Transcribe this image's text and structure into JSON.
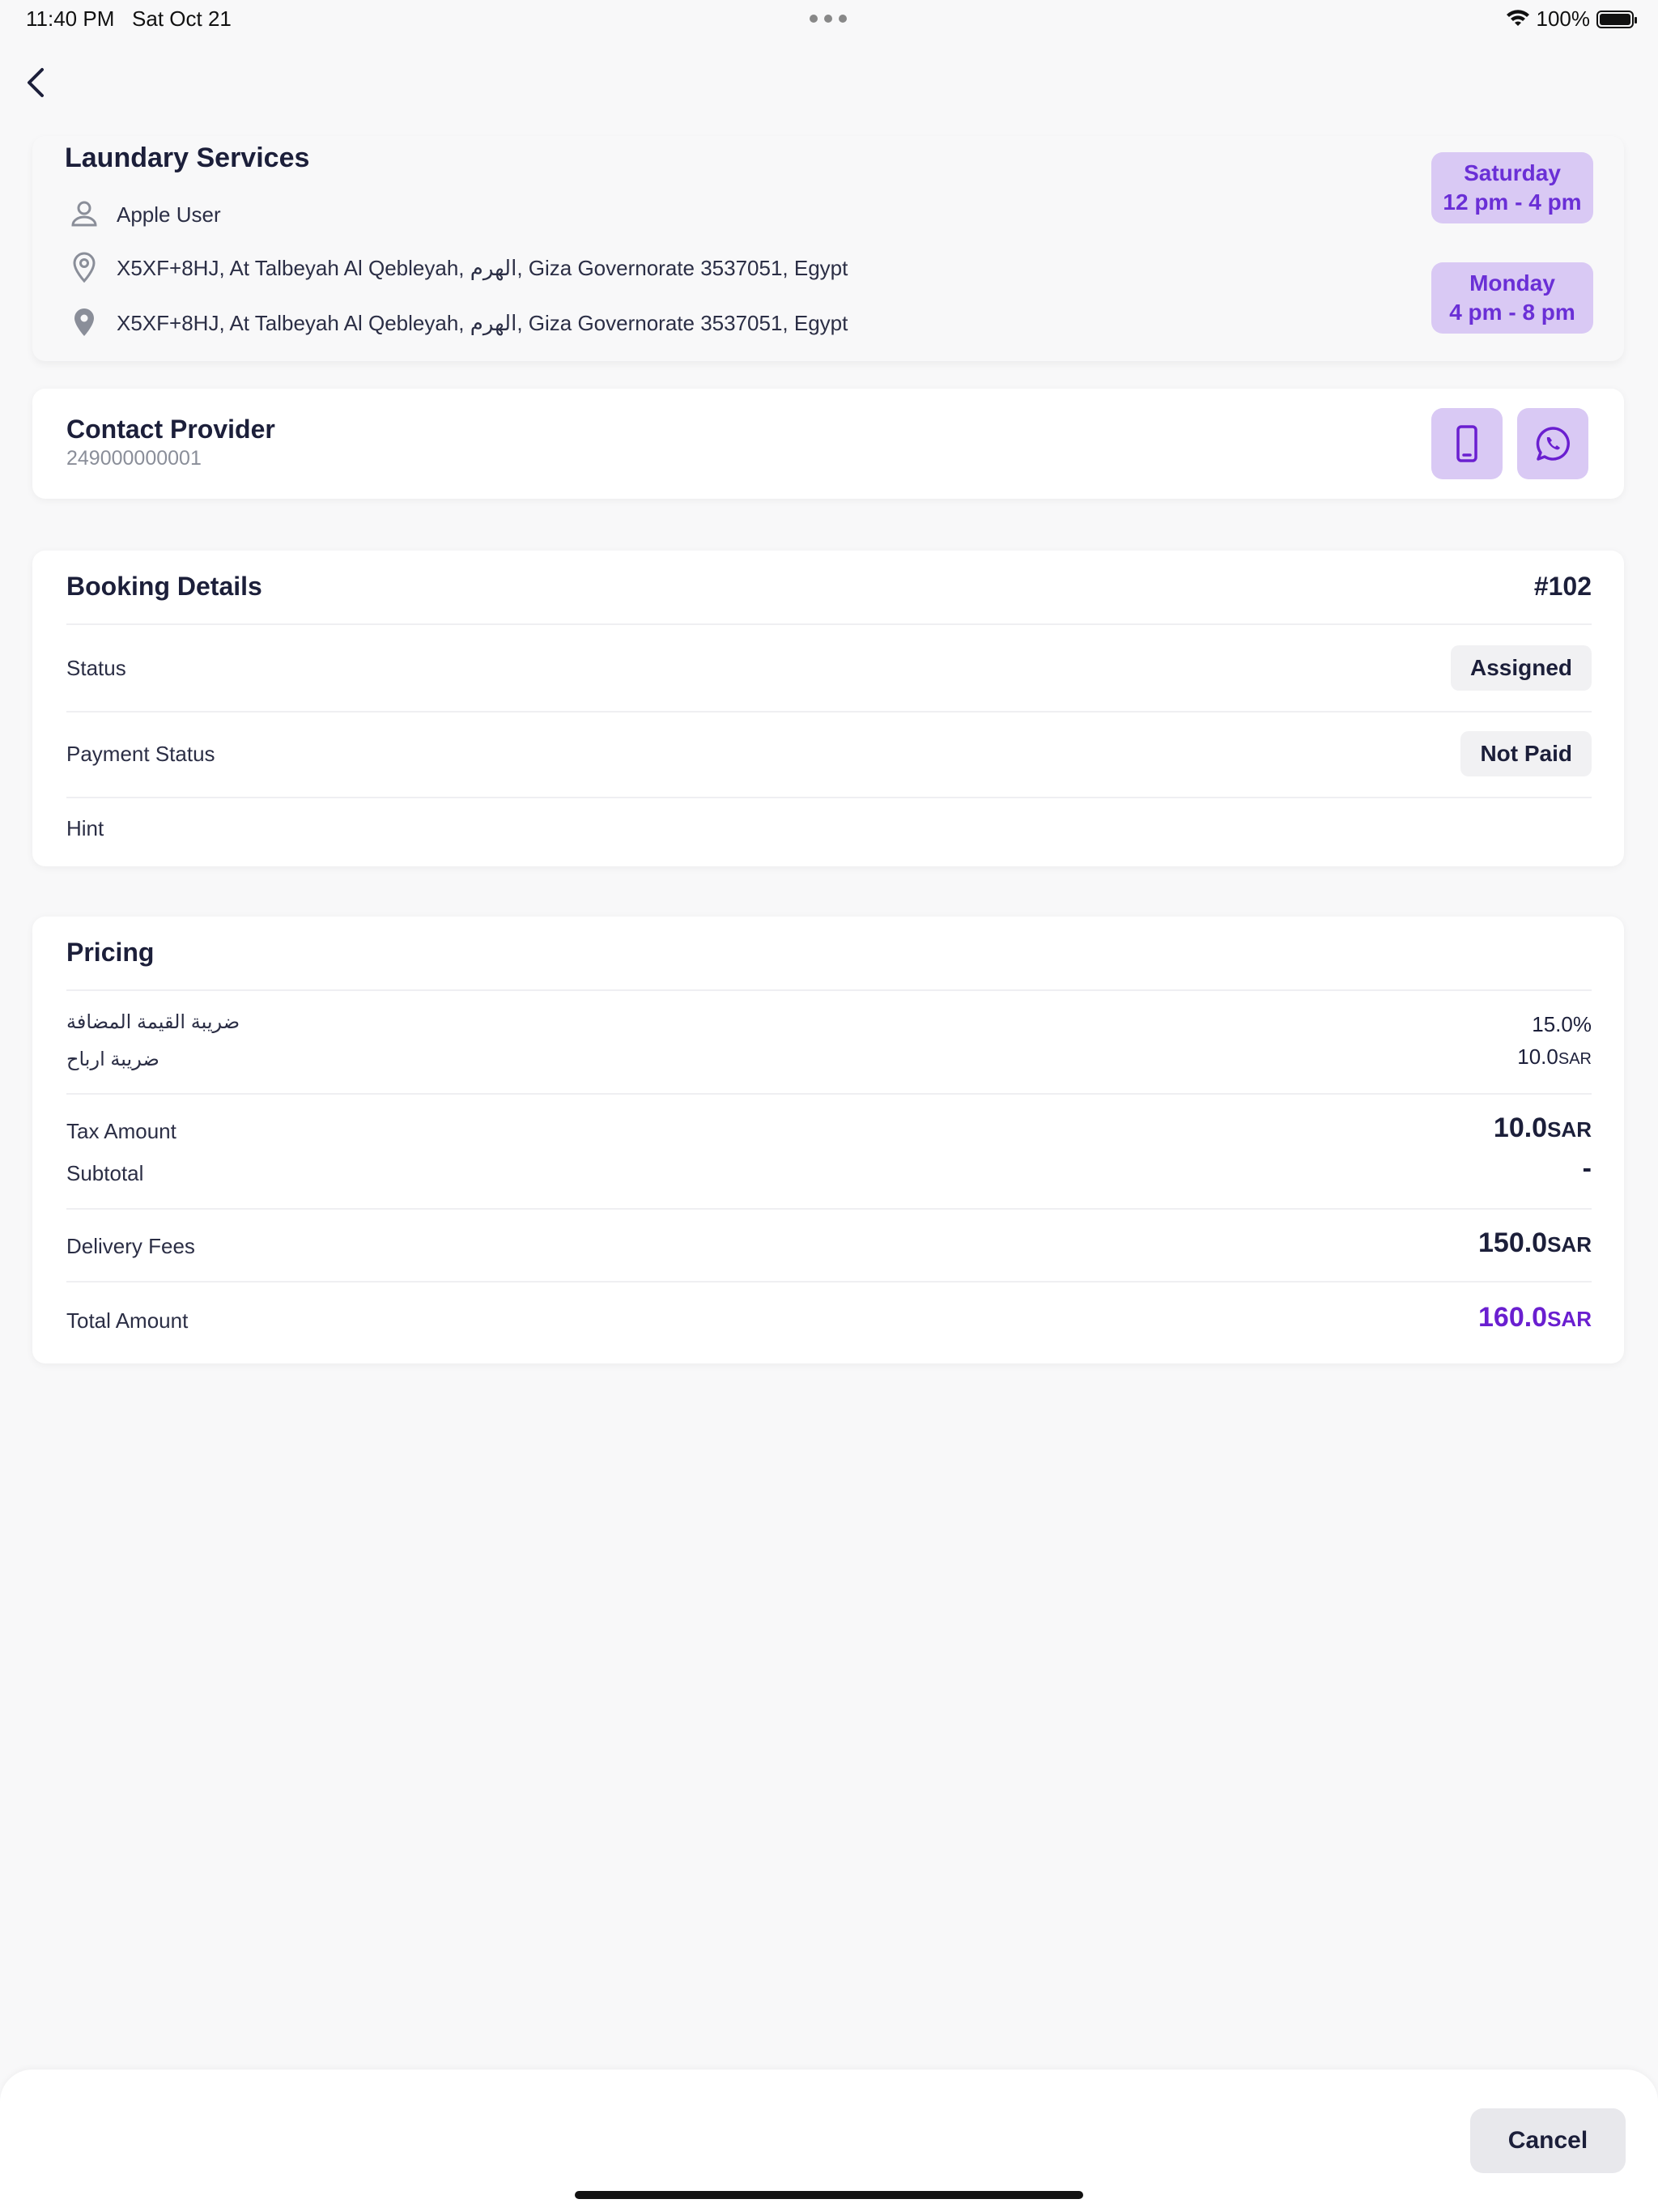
{
  "status_bar": {
    "time": "11:40 PM",
    "date": "Sat Oct 21",
    "battery": "100%"
  },
  "service": {
    "title": "Laundary Services",
    "user": "Apple User",
    "pickup_address": "X5XF+8HJ, At Talbeyah Al Qebleyah, الهرم, Giza Governorate 3537051, Egypt",
    "dropoff_address": "X5XF+8HJ, At Talbeyah Al Qebleyah, الهرم, Giza Governorate 3537051, Egypt",
    "slots": [
      {
        "day": "Saturday",
        "time": "12 pm - 4 pm"
      },
      {
        "day": "Monday",
        "time": "4 pm - 8 pm"
      }
    ]
  },
  "contact": {
    "title": "Contact Provider",
    "phone": "249000000001"
  },
  "booking": {
    "title": "Booking Details",
    "id": "#102",
    "status_label": "Status",
    "status_value": "Assigned",
    "payment_label": "Payment Status",
    "payment_value": "Not Paid",
    "hint_label": "Hint"
  },
  "pricing": {
    "title": "Pricing",
    "taxes": [
      {
        "name": "ضريبة القيمة المضافة",
        "value": "15.0%",
        "currency": ""
      },
      {
        "name": "ضريبة ارباح",
        "value": "10.0",
        "currency": "SAR"
      }
    ],
    "tax_amount_label": "Tax Amount",
    "tax_amount_value": "10.0",
    "subtotal_label": "Subtotal",
    "subtotal_value": "-",
    "delivery_label": "Delivery Fees",
    "delivery_value": "150.0",
    "total_label": "Total Amount",
    "total_value": "160.0",
    "currency": "SAR"
  },
  "actions": {
    "cancel_label": "Cancel"
  },
  "colors": {
    "accent": "#6a1fd0",
    "accent_bg": "#d9c9f4"
  }
}
